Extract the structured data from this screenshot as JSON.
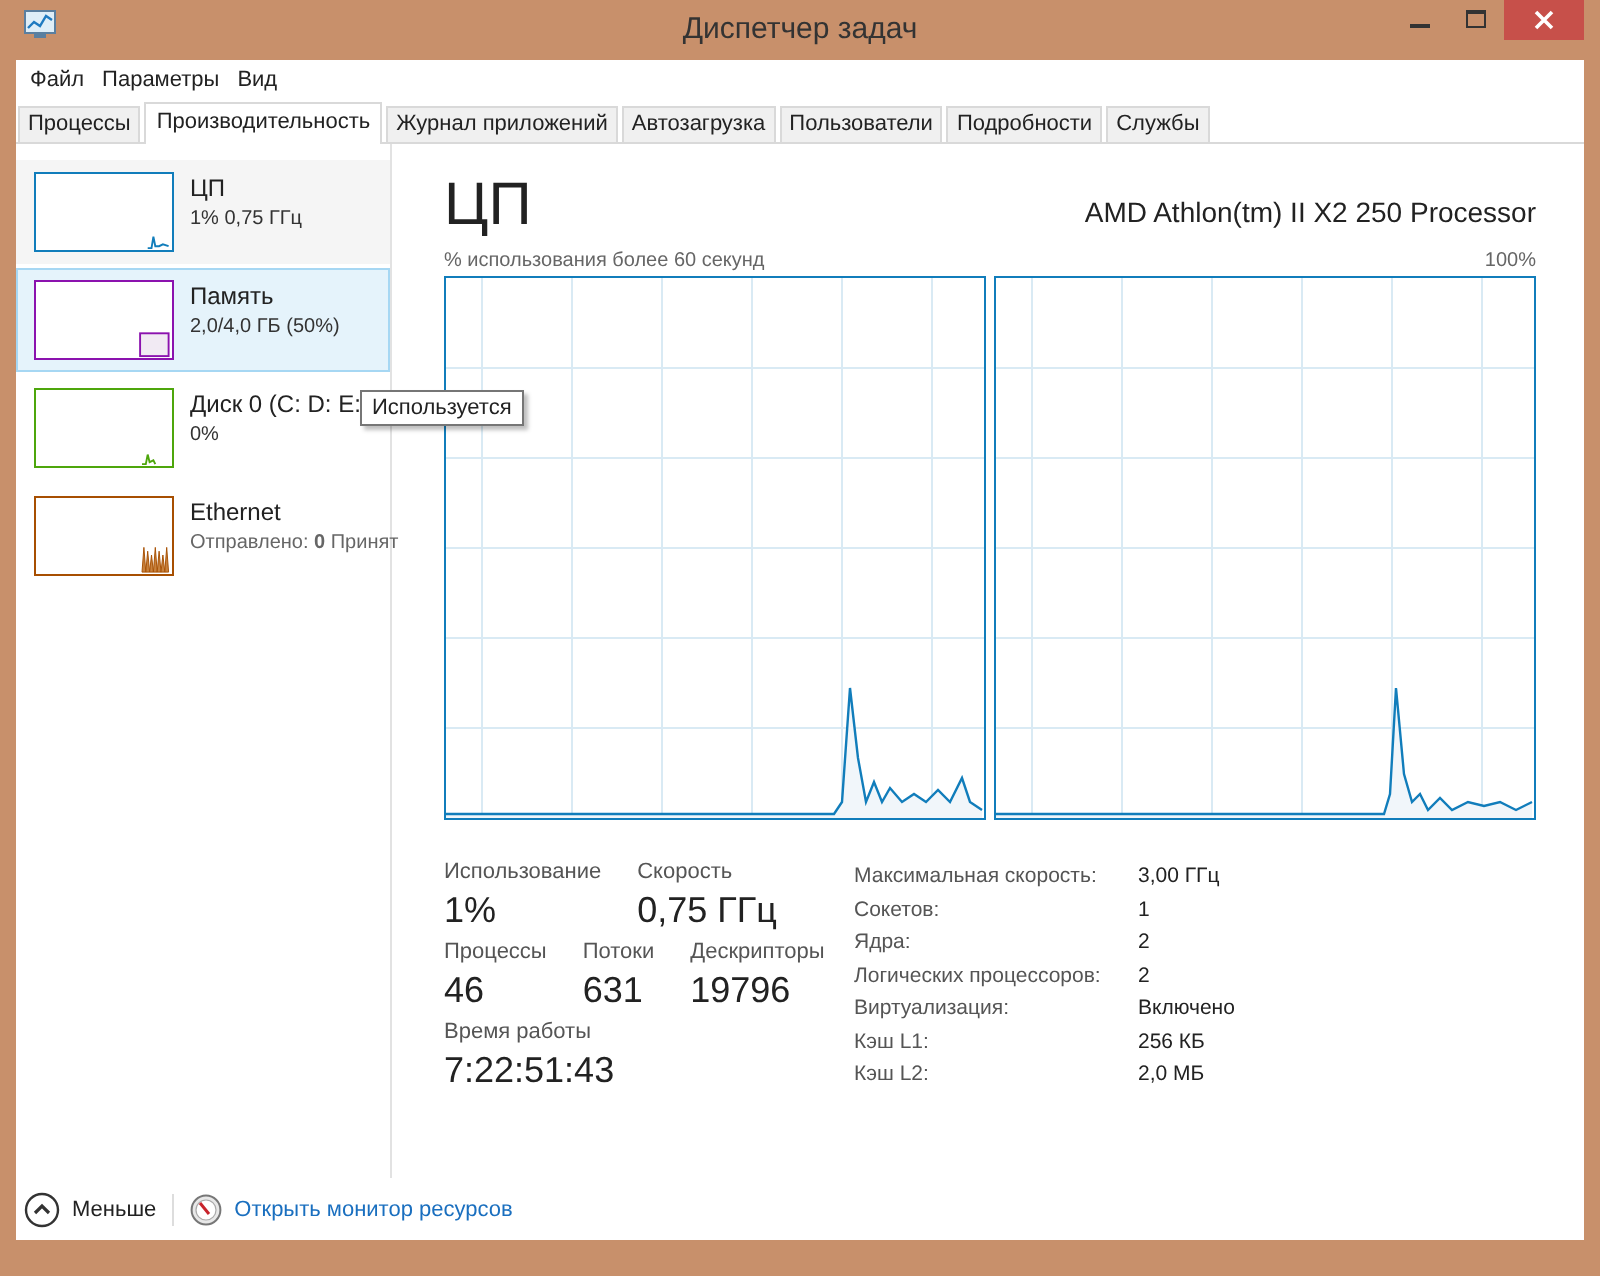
{
  "window": {
    "title": "Диспетчер задач"
  },
  "menu": [
    "Файл",
    "Параметры",
    "Вид"
  ],
  "tabs": [
    {
      "label": "Процессы",
      "selected": false
    },
    {
      "label": "Производительность",
      "selected": true
    },
    {
      "label": "Журнал приложений",
      "selected": false
    },
    {
      "label": "Автозагрузка",
      "selected": false
    },
    {
      "label": "Пользователи",
      "selected": false
    },
    {
      "label": "Подробности",
      "selected": false
    },
    {
      "label": "Службы",
      "selected": false
    }
  ],
  "sidebar": {
    "items": [
      {
        "kind": "cpu",
        "name": "ЦП",
        "detail": "1% 0,75 ГГц",
        "color": "#117dbb",
        "selected": false
      },
      {
        "kind": "memory",
        "name": "Память",
        "detail": "2,0/4,0 ГБ (50%)",
        "color": "#8b12ae",
        "selected": true
      },
      {
        "kind": "disk",
        "name": "Диск 0 (C: D: E:",
        "detail": "0%",
        "color": "#4da60c",
        "selected": false
      },
      {
        "kind": "ethernet",
        "name": "Ethernet",
        "detail": "Отправлено: **0** Принят",
        "color": "#a74f01",
        "selected": false
      }
    ]
  },
  "tooltip": "Используется",
  "main": {
    "title": "ЦП",
    "processor": "AMD Athlon(tm) II X2 250 Processor",
    "graph_caption": "% использования более 60 секунд",
    "graph_max": "100%",
    "stat_rows": [
      [
        {
          "label": "Использование",
          "value": "1%"
        },
        {
          "label": "Скорость",
          "value": "0,75 ГГц"
        }
      ],
      [
        {
          "label": "Процессы",
          "value": "46"
        },
        {
          "label": "Потоки",
          "value": "631"
        },
        {
          "label": "Дескрипторы",
          "value": "19796"
        }
      ],
      [
        {
          "label": "Время работы",
          "value": "7:22:51:43"
        }
      ]
    ],
    "details": [
      {
        "label": "Максимальная скорость:",
        "value": "3,00 ГГц"
      },
      {
        "label": "Сокетов:",
        "value": "1"
      },
      {
        "label": "Ядра:",
        "value": "2"
      },
      {
        "label": "Логических процессоров:",
        "value": "2"
      },
      {
        "label": "Виртуализация:",
        "value": "Включено"
      },
      {
        "label": "Кэш L1:",
        "value": "256 КБ"
      },
      {
        "label": "Кэш L2:",
        "value": "2,0 МБ"
      }
    ]
  },
  "footer": {
    "fewer": "Меньше",
    "monitor_link": "Открыть монитор ресурсов"
  }
}
